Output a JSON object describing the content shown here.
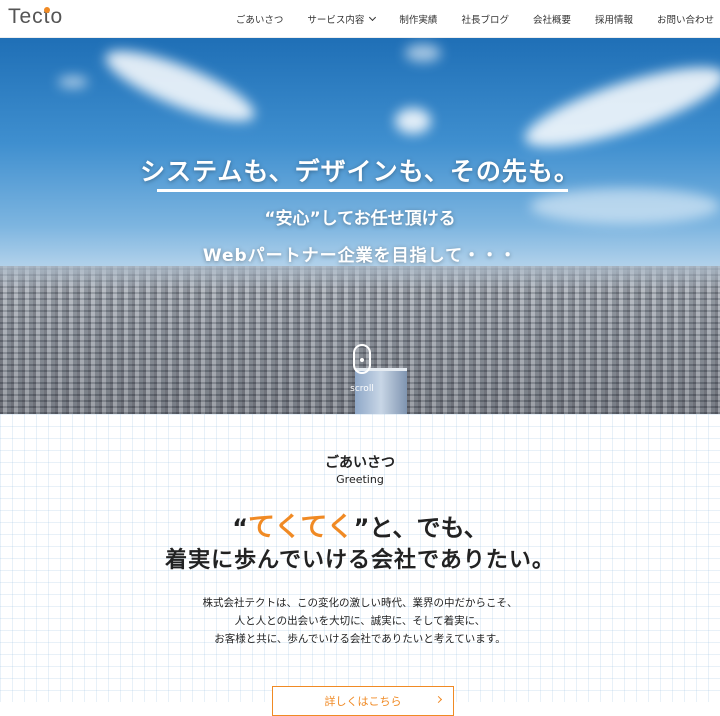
{
  "header": {
    "logo": "Tecto",
    "nav": [
      {
        "label": "ごあいさつ"
      },
      {
        "label": "サービス内容"
      },
      {
        "label": "制作実績"
      },
      {
        "label": "社長ブログ"
      },
      {
        "label": "会社概要"
      },
      {
        "label": "採用情報"
      },
      {
        "label": "お問い合わせ"
      }
    ]
  },
  "hero": {
    "title": "システムも、デザインも、その先も。",
    "subtitle1": "“安心”してお任せ頂ける",
    "subtitle2": "Webパートナー企業を目指して・・・",
    "scroll_label": "scroll"
  },
  "greeting": {
    "heading_ja": "ごあいさつ",
    "heading_en": "Greeting",
    "catch_open": "“",
    "catch_accent": "てくてく",
    "catch_close": "”と、でも、",
    "catch_line2": "着実に歩んでいける会社でありたい。",
    "body_line1": "株式会社テクトは、この変化の激しい時代、業界の中だからこそ、",
    "body_line2": "人と人との出会いを大切に、誠実に、そして着実に、",
    "body_line3": "お客様と共に、歩んでいける会社でありたいと考えています。",
    "more_button": "詳しくはこちら"
  },
  "colors": {
    "accent": "#f08a24",
    "sky": "#3f8fcf",
    "text": "#222222"
  },
  "icons": {
    "nav_dropdown": "chevron-down-icon",
    "scroll": "mouse-scroll-icon",
    "button_arrow": "chevron-right-icon"
  }
}
